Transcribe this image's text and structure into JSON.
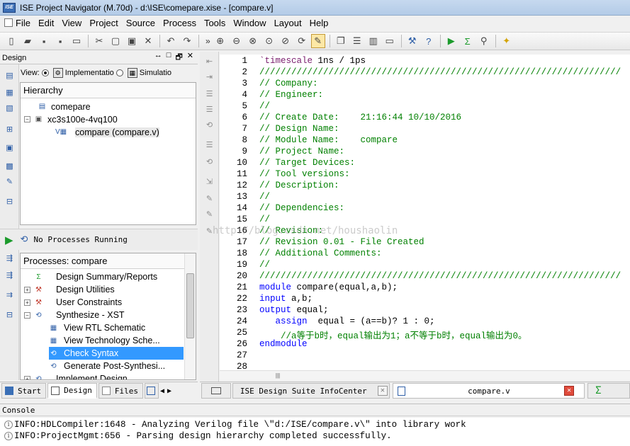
{
  "window": {
    "title": "ISE Project Navigator (M.70d) - d:\\ISE\\comepare.xise - [compare.v]",
    "logo": "ISE"
  },
  "menu": [
    "File",
    "Edit",
    "View",
    "Project",
    "Source",
    "Process",
    "Tools",
    "Window",
    "Layout",
    "Help"
  ],
  "toolbar": {
    "icons": [
      "new-file-icon",
      "open-folder-icon",
      "save-icon",
      "save-all-icon",
      "print-icon",
      "cut-icon",
      "copy-icon",
      "paste-icon",
      "delete-icon",
      "undo-icon",
      "redo-icon",
      "zoom-in-icon",
      "zoom-out-icon",
      "zoom-fit-icon",
      "zoom-area-icon",
      "zoom-prev-icon",
      "refresh-icon",
      "pencil-icon",
      "cascade-icon",
      "tile-h-icon",
      "tile-v-icon",
      "window-icon",
      "wrench-icon",
      "help-query-icon",
      "run-icon",
      "sigma-icon",
      "telescope-icon",
      "bulb-icon"
    ],
    "overflow": "»"
  },
  "design_panel": {
    "header": "Design",
    "controls": [
      "↔",
      "□",
      "🗗",
      "✕"
    ],
    "view_label": "View:",
    "implementation_label": "Implementatio",
    "simulation_label": "Simulatio",
    "hierarchy_title": "Hierarchy",
    "tree": [
      {
        "label": "comepare",
        "icon": "project-file-icon",
        "indent": 0
      },
      {
        "label": "xc3s100e-4vq100",
        "icon": "chip-icon",
        "indent": 0,
        "expander": "−"
      },
      {
        "label": "compare (compare.v)",
        "icon": "verilog-module-icon",
        "indent": 1,
        "selected": true
      }
    ]
  },
  "process_panel": {
    "status": "No Processes Running",
    "title": "Processes: compare",
    "items": [
      {
        "label": "Design Summary/Reports",
        "icon": "sigma-icon",
        "indent": 0
      },
      {
        "label": "Design Utilities",
        "icon": "tools-icon",
        "indent": 0,
        "expander": "+"
      },
      {
        "label": "User Constraints",
        "icon": "tools-icon",
        "indent": 0,
        "expander": "+"
      },
      {
        "label": "Synthesize - XST",
        "icon": "process-icon",
        "indent": 0,
        "expander": "−"
      },
      {
        "label": "View RTL Schematic",
        "icon": "schematic-icon",
        "indent": 1
      },
      {
        "label": "View Technology Sche...",
        "icon": "schematic-icon",
        "indent": 1
      },
      {
        "label": "Check Syntax",
        "icon": "process-icon",
        "indent": 1,
        "selected": true
      },
      {
        "label": "Generate Post-Synthesi...",
        "icon": "process-icon",
        "indent": 1
      },
      {
        "label": "Implement Design",
        "icon": "process-icon",
        "indent": 0,
        "expander": "+"
      }
    ]
  },
  "left_tabs": [
    "Start",
    "Design",
    "Files"
  ],
  "editor": {
    "line_numbers": [
      "1",
      "2",
      "3",
      "4",
      "5",
      "6",
      "7",
      "8",
      "9",
      "10",
      "11",
      "12",
      "13",
      "14",
      "15",
      "16",
      "17",
      "18",
      "19",
      "20",
      "21",
      "22",
      "23",
      "24",
      "25",
      "26",
      "27",
      "28"
    ],
    "lines": [
      [
        {
          "t": "`timescale",
          "c": "tick"
        },
        {
          "t": " 1ns / 1ps",
          "c": "plain"
        }
      ],
      [
        {
          "t": "////////////////////////////////////////////////////////////////////",
          "c": "comment"
        }
      ],
      [
        {
          "t": "// Company:",
          "c": "comment"
        }
      ],
      [
        {
          "t": "// Engineer:",
          "c": "comment"
        }
      ],
      [
        {
          "t": "//",
          "c": "comment"
        }
      ],
      [
        {
          "t": "// Create Date:    21:16:44 10/10/2016",
          "c": "comment"
        }
      ],
      [
        {
          "t": "// Design Name:",
          "c": "comment"
        }
      ],
      [
        {
          "t": "// Module Name:    compare",
          "c": "comment"
        }
      ],
      [
        {
          "t": "// Project Name:",
          "c": "comment"
        }
      ],
      [
        {
          "t": "// Target Devices:",
          "c": "comment"
        }
      ],
      [
        {
          "t": "// Tool versions:",
          "c": "comment"
        }
      ],
      [
        {
          "t": "// Description:",
          "c": "comment"
        }
      ],
      [
        {
          "t": "//",
          "c": "comment"
        }
      ],
      [
        {
          "t": "// Dependencies:",
          "c": "comment"
        }
      ],
      [
        {
          "t": "//",
          "c": "comment"
        }
      ],
      [
        {
          "t": "// Revision:",
          "c": "comment"
        }
      ],
      [
        {
          "t": "// Revision 0.01 - File Created",
          "c": "comment"
        }
      ],
      [
        {
          "t": "// Additional Comments:",
          "c": "comment"
        }
      ],
      [
        {
          "t": "//",
          "c": "comment"
        }
      ],
      [
        {
          "t": "////////////////////////////////////////////////////////////////////",
          "c": "comment"
        }
      ],
      [
        {
          "t": "module",
          "c": "kw"
        },
        {
          "t": " compare(equal,a,b);",
          "c": "plain"
        }
      ],
      [
        {
          "t": "input",
          "c": "kw"
        },
        {
          "t": " a,b;",
          "c": "plain"
        }
      ],
      [
        {
          "t": "output",
          "c": "kw"
        },
        {
          "t": " equal;",
          "c": "plain"
        }
      ],
      [
        {
          "t": "   assign",
          "c": "kw"
        },
        {
          "t": "  equal = (a==b)? 1 : 0;",
          "c": "plain"
        }
      ],
      [
        {
          "t": "    //a等于b时，equal输出为1；a不等于b时，equal输出为0。",
          "c": "comment"
        }
      ],
      [
        {
          "t": "endmodule",
          "c": "kw"
        }
      ],
      [],
      []
    ],
    "watermark": "http://blog.csdn.net/houshaolin"
  },
  "right_tabs": [
    {
      "label": "ISE Design Suite InfoCenter",
      "icon": "infocenter-icon",
      "close": "✕"
    },
    {
      "label": "compare.v",
      "icon": "document-icon",
      "close": "✕",
      "active": true
    },
    {
      "label": "Σ",
      "icon": "sigma-icon"
    }
  ],
  "console": {
    "title": "Console",
    "lines": [
      "INFO:HDLCompiler:1648 - Analyzing Verilog file \\\"d:/ISE/compare.v\\\" into library work",
      "INFO:ProjectMgmt:656 - Parsing design hierarchy completed successfully."
    ]
  }
}
